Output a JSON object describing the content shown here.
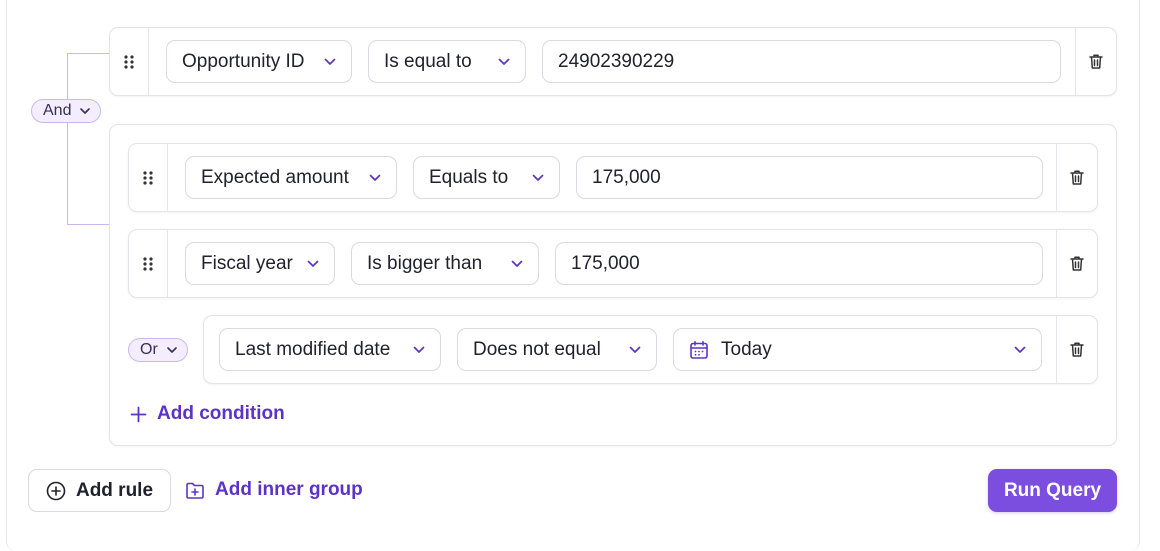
{
  "root_group": {
    "combinator": "And",
    "first_rule": {
      "field": "Opportunity ID",
      "operator": "Is equal to",
      "value": "24902390229"
    }
  },
  "inner_group": {
    "rules": [
      {
        "field": "Expected amount",
        "operator": "Equals to",
        "value": "175,000"
      },
      {
        "field": "Fiscal year",
        "operator": "Is bigger than",
        "value": "175,000"
      }
    ],
    "sub_group": {
      "combinator": "Or",
      "rule": {
        "field": "Last modified date",
        "operator": "Does not equal",
        "value": "Today",
        "value_icon": "calendar-icon"
      }
    },
    "add_condition_label": "Add condition"
  },
  "footer": {
    "add_rule_label": "Add rule",
    "add_inner_group_label": "Add inner group",
    "run_query_label": "Run Query"
  },
  "colors": {
    "accent": "#7b4ee0",
    "accent_text": "#5b34c7",
    "pill_bg": "#f3edfd",
    "pill_border": "#c9b8ef"
  }
}
